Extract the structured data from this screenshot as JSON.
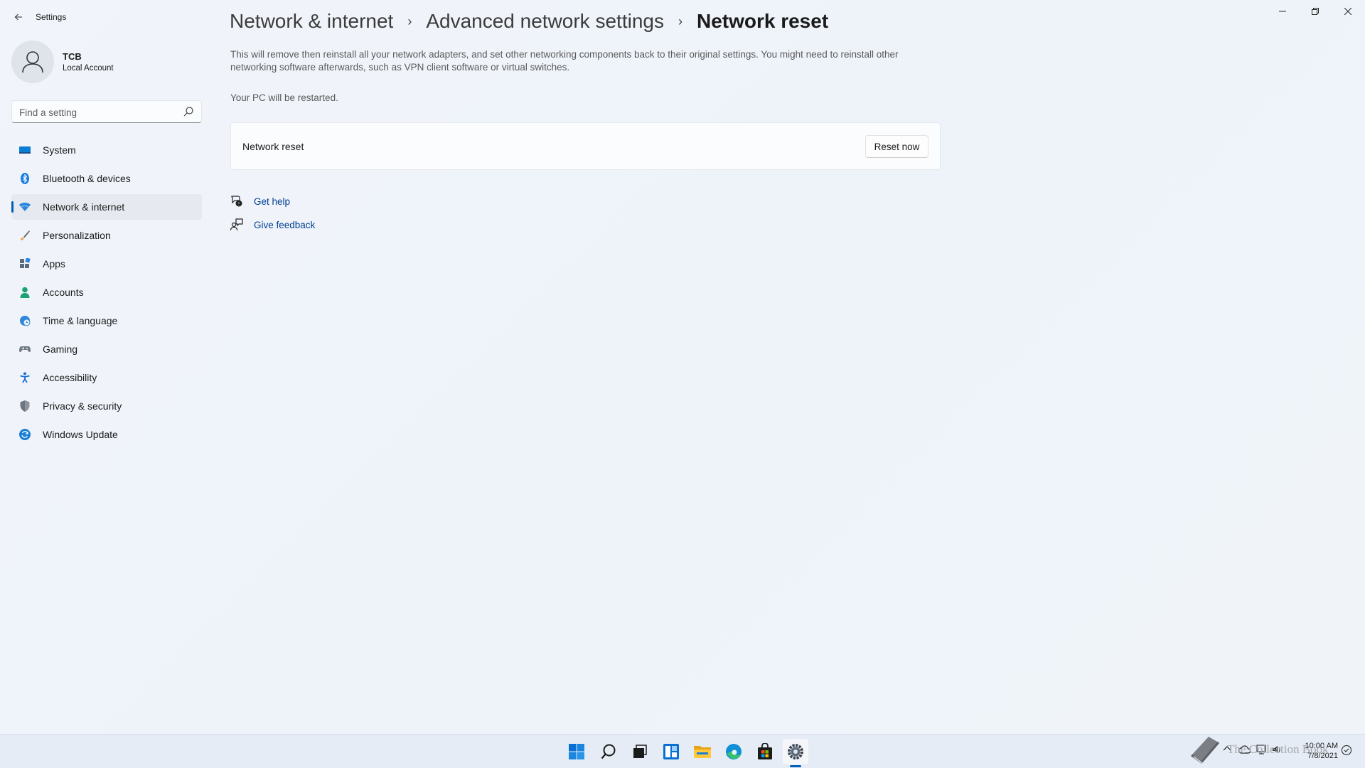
{
  "window": {
    "app_title": "Settings",
    "controls": {
      "minimize": "minimize-icon",
      "restore": "restore-icon",
      "close": "close-icon"
    }
  },
  "profile": {
    "name": "TCB",
    "account_type": "Local Account"
  },
  "search": {
    "placeholder": "Find a setting"
  },
  "sidebar": {
    "items": [
      {
        "label": "System",
        "icon": "system-icon"
      },
      {
        "label": "Bluetooth & devices",
        "icon": "bluetooth-icon"
      },
      {
        "label": "Network & internet",
        "icon": "wifi-icon",
        "active": true
      },
      {
        "label": "Personalization",
        "icon": "brush-icon"
      },
      {
        "label": "Apps",
        "icon": "apps-icon"
      },
      {
        "label": "Accounts",
        "icon": "accounts-icon"
      },
      {
        "label": "Time & language",
        "icon": "globe-clock-icon"
      },
      {
        "label": "Gaming",
        "icon": "gamepad-icon"
      },
      {
        "label": "Accessibility",
        "icon": "accessibility-icon"
      },
      {
        "label": "Privacy & security",
        "icon": "shield-icon"
      },
      {
        "label": "Windows Update",
        "icon": "update-icon"
      }
    ]
  },
  "breadcrumb": {
    "items": [
      "Network & internet",
      "Advanced network settings"
    ],
    "separator": "›",
    "current": "Network reset"
  },
  "content": {
    "description": "This will remove then reinstall all your network adapters, and set other networking components back to their original settings. You might need to reinstall other networking software afterwards, such as VPN client software or virtual switches.",
    "restart_note": "Your PC will be restarted.",
    "card": {
      "label": "Network reset",
      "button": "Reset now"
    },
    "links": [
      {
        "label": "Get help",
        "icon": "help-icon"
      },
      {
        "label": "Give feedback",
        "icon": "feedback-icon"
      }
    ]
  },
  "taskbar": {
    "icons": [
      "start-icon",
      "search-icon",
      "task-view-icon",
      "widgets-icon",
      "file-explorer-icon",
      "edge-icon",
      "store-icon",
      "settings-icon"
    ],
    "active": "settings-icon",
    "clock": {
      "time": "10:00 AM",
      "date": "7/8/2021"
    }
  },
  "watermark": {
    "text": "The Collection Book"
  },
  "colors": {
    "accent": "#005fb8",
    "link": "#003e92",
    "background": "#eef3f9"
  }
}
